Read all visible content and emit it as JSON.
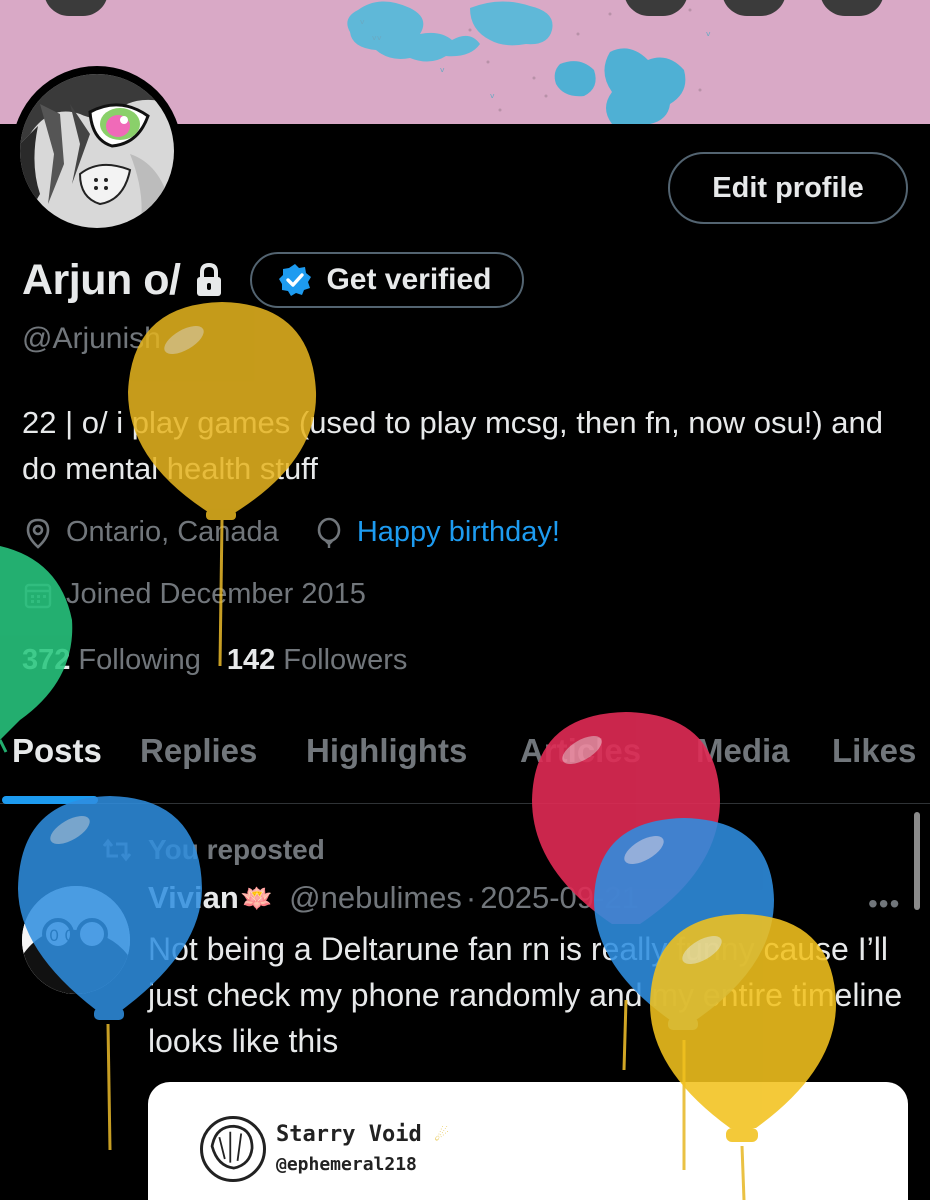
{
  "profile": {
    "display_name": "Arjun o/",
    "verify_label": "Get verified",
    "handle": "@Arjunish",
    "bio": "22 | o/ i play games (used to play mcsg, then fn, now osu!) and do mental health stuff",
    "location": "Ontario, Canada",
    "birthday": "Happy birthday!",
    "joined": "Joined December 2015",
    "following_count": "372",
    "following_label": "Following",
    "followers_count": "142",
    "followers_label": "Followers",
    "edit_label": "Edit profile"
  },
  "tabs": [
    "Posts",
    "Replies",
    "Highlights",
    "Articles",
    "Media",
    "Likes"
  ],
  "active_tab": "Posts",
  "post": {
    "repost_label": "You reposted",
    "author": "Vivian",
    "author_emoji": "🪷",
    "handle": "@nebulimes",
    "separator": "·",
    "date": "2025-09-21",
    "text": "Not being a Deltarune fan rn is really funny cause I’ll just check my phone randomly and my entire timeline looks like this",
    "more": "•••",
    "embed": {
      "name": "Starry Void",
      "handle": "@ephemeral218"
    }
  },
  "icons": {
    "lock": "lock-icon",
    "verified": "verified-badge-icon",
    "location": "location-pin-icon",
    "birthday": "balloon-icon",
    "calendar": "calendar-icon",
    "repost": "repost-icon",
    "more": "more-icon"
  },
  "colors": {
    "accent": "#1d9bf0",
    "muted": "#71767b",
    "text": "#e7e9ea",
    "border": "#536471"
  }
}
